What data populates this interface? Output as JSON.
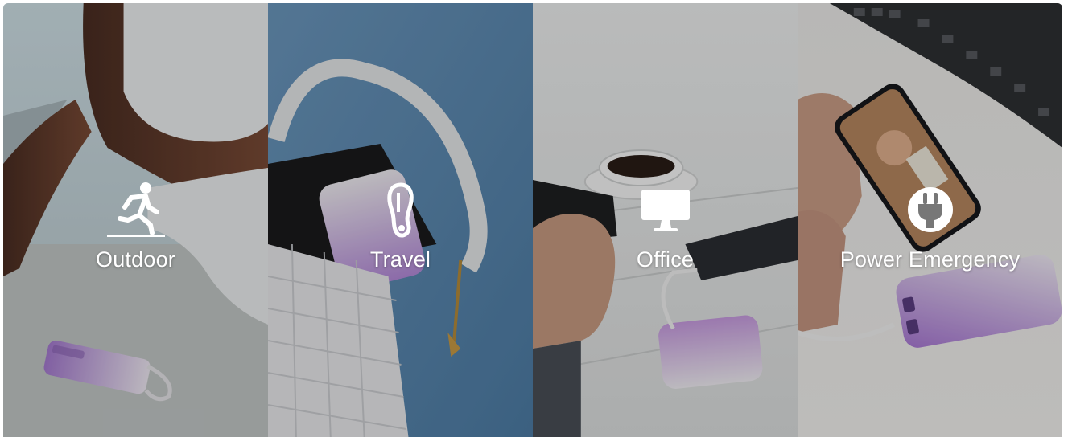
{
  "scenarios": [
    {
      "label": "Outdoor",
      "icon": "running-person-icon"
    },
    {
      "label": "Travel",
      "icon": "carabiner-icon"
    },
    {
      "label": "Office",
      "icon": "desktop-monitor-icon"
    },
    {
      "label": "Power Emergency",
      "icon": "plug-icon"
    }
  ],
  "colors": {
    "overlay": "#00000038",
    "device_lilac": "#b78fd8",
    "device_white": "#f1eef6",
    "travel_blue": "#5a86ad"
  }
}
